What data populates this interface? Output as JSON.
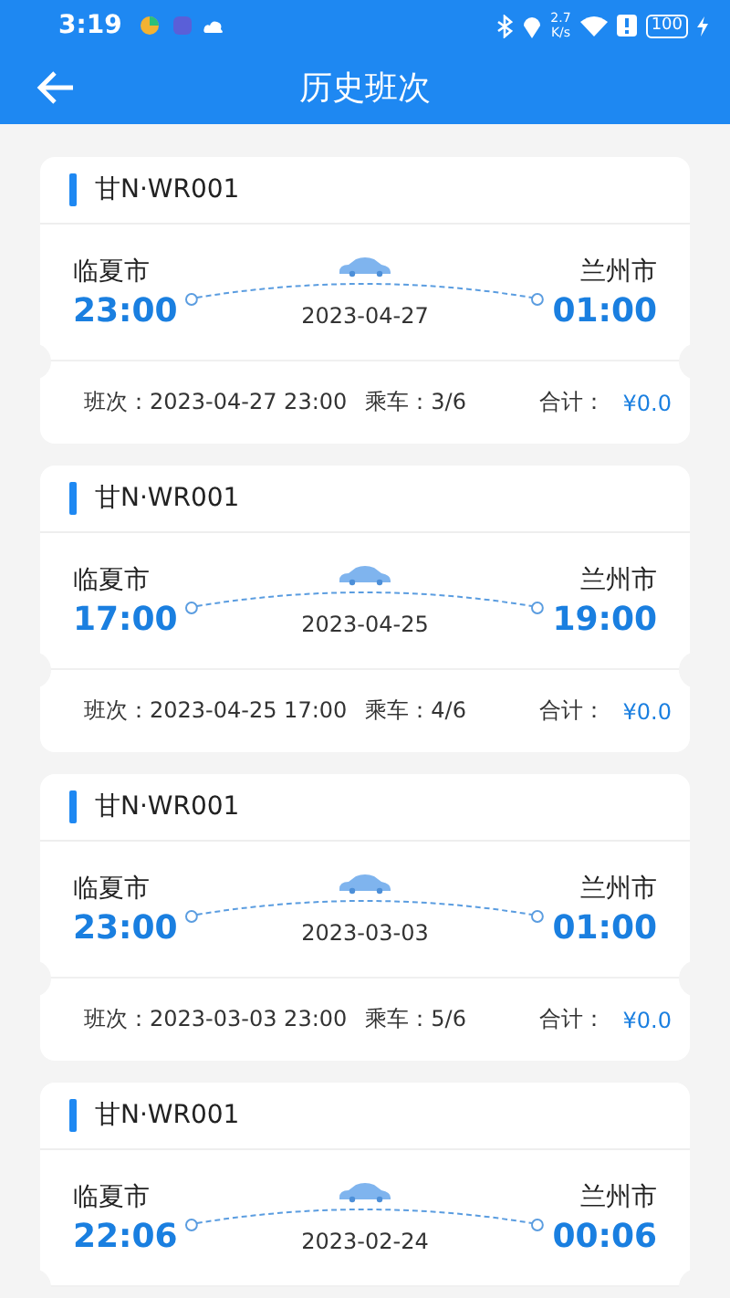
{
  "status_bar": {
    "time": "3:19",
    "net_speed": "2.7",
    "net_unit": "K/s",
    "battery": "100"
  },
  "header": {
    "title": "历史班次"
  },
  "trips": [
    {
      "plate": "甘N·WR001",
      "from": "临夏市",
      "depart": "23:00",
      "to": "兰州市",
      "arrive": "01:00",
      "date": "2023-04-27",
      "schedule": "班次：2023-04-27 23:00",
      "seats": "乘车：3/6",
      "total_label": "合计：",
      "total": "¥0.0"
    },
    {
      "plate": "甘N·WR001",
      "from": "临夏市",
      "depart": "17:00",
      "to": "兰州市",
      "arrive": "19:00",
      "date": "2023-04-25",
      "schedule": "班次：2023-04-25 17:00",
      "seats": "乘车：4/6",
      "total_label": "合计：",
      "total": "¥0.0"
    },
    {
      "plate": "甘N·WR001",
      "from": "临夏市",
      "depart": "23:00",
      "to": "兰州市",
      "arrive": "01:00",
      "date": "2023-03-03",
      "schedule": "班次：2023-03-03 23:00",
      "seats": "乘车：5/6",
      "total_label": "合计：",
      "total": "¥0.0"
    },
    {
      "plate": "甘N·WR001",
      "from": "临夏市",
      "depart": "22:06",
      "to": "兰州市",
      "arrive": "00:06",
      "date": "2023-02-24"
    }
  ]
}
